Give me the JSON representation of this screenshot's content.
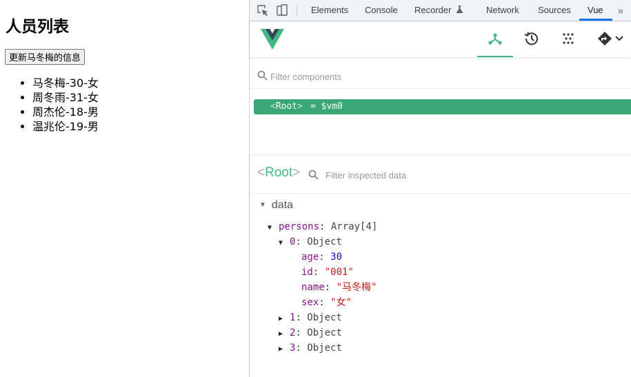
{
  "app": {
    "title": "人员列表",
    "update_button": "更新马冬梅的信息",
    "persons": [
      "马冬梅-30-女",
      "周冬雨-31-女",
      "周杰伦-18-男",
      "温兆伦-19-男"
    ]
  },
  "devtools_tabs": [
    "Elements",
    "Console",
    "Recorder",
    "Network",
    "Sources",
    "Vue"
  ],
  "active_tab": "Vue",
  "vue_toolbar": {
    "active": "components",
    "buttons": [
      "components-icon",
      "history-icon",
      "vuex-icon",
      "router-icon"
    ]
  },
  "components_filter": {
    "placeholder": "Filter components"
  },
  "tree": {
    "root_tag": "Root",
    "vm": "= $vm0"
  },
  "inspector": {
    "title": "Root",
    "filter_placeholder": "Filter inspected data",
    "section": "data",
    "persons_key": "persons",
    "persons_type": "Array[4]",
    "item0_key": "0",
    "item0_type": "Object",
    "fields": [
      {
        "key": "age",
        "value": "30",
        "kind": "num"
      },
      {
        "key": "id",
        "value": "\"001\"",
        "kind": "str"
      },
      {
        "key": "name",
        "value": "\"马冬梅\"",
        "kind": "str"
      },
      {
        "key": "sex",
        "value": "\"女\"",
        "kind": "str"
      }
    ],
    "collapsed_items": [
      {
        "key": "1",
        "type": "Object"
      },
      {
        "key": "2",
        "type": "Object"
      },
      {
        "key": "3",
        "type": "Object"
      }
    ]
  },
  "colors": {
    "vue_green": "#42b883",
    "row_selected": "#3ba776",
    "chrome_blue": "#1a73e8"
  }
}
